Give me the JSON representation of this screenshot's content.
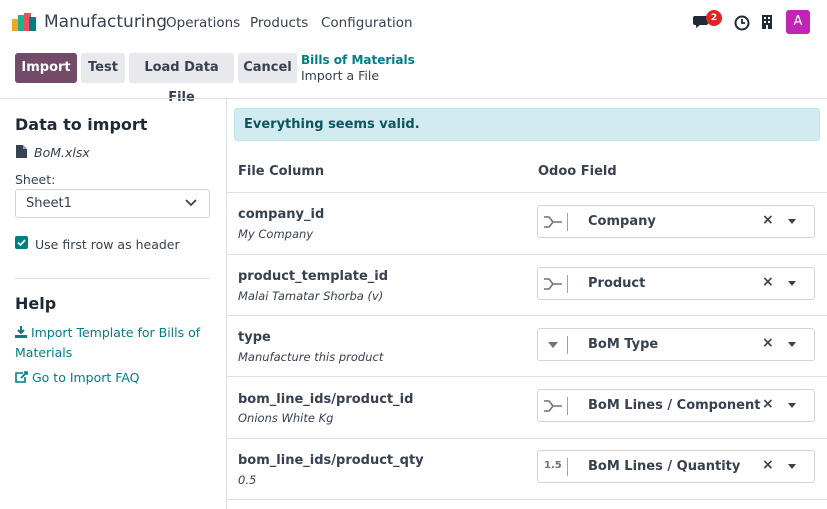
{
  "navbar": {
    "app_title": "Manufacturing",
    "menu": [
      "Operations",
      "Products",
      "Configuration"
    ],
    "message_count": "2",
    "avatar_letter": "A"
  },
  "control_panel": {
    "import_label": "Import",
    "test_label": "Test",
    "load_label": "Load Data File",
    "cancel_label": "Cancel",
    "breadcrumb_parent": "Bills of Materials",
    "breadcrumb_current": "Import a File"
  },
  "sidebar": {
    "data_title": "Data to import",
    "file_name": "BoM.xlsx",
    "sheet_label": "Sheet:",
    "sheet_value": "Sheet1",
    "header_checkbox_label": "Use first row as header",
    "header_checked": true,
    "help_title": "Help",
    "template_link": "Import Template for Bills of Materials",
    "faq_link": "Go to Import FAQ"
  },
  "main": {
    "alert": "Everything seems valid.",
    "col_file": "File Column",
    "col_field": "Odoo Field",
    "rows": [
      {
        "column": "company_id",
        "sample": "My Company",
        "field": "Company",
        "icon": "relation-icon"
      },
      {
        "column": "product_template_id",
        "sample": "Malai Tamatar Shorba (v)",
        "field": "Product",
        "icon": "relation-icon"
      },
      {
        "column": "type",
        "sample": "Manufacture this product",
        "field": "BoM Type",
        "icon": "selection-icon"
      },
      {
        "column": "bom_line_ids/product_id",
        "sample": "Onions White Kg",
        "field": "BoM Lines / Component",
        "icon": "relation-icon"
      },
      {
        "column": "bom_line_ids/product_qty",
        "sample": "0.5",
        "field": "BoM Lines / Quantity",
        "icon": "float-icon",
        "icon_text": "1.5"
      }
    ]
  },
  "colors": {
    "primary": "#714b67",
    "link": "#017e84",
    "alert_bg": "#d1ecf1",
    "badge": "#e02424",
    "avatar": "#c026b3"
  }
}
